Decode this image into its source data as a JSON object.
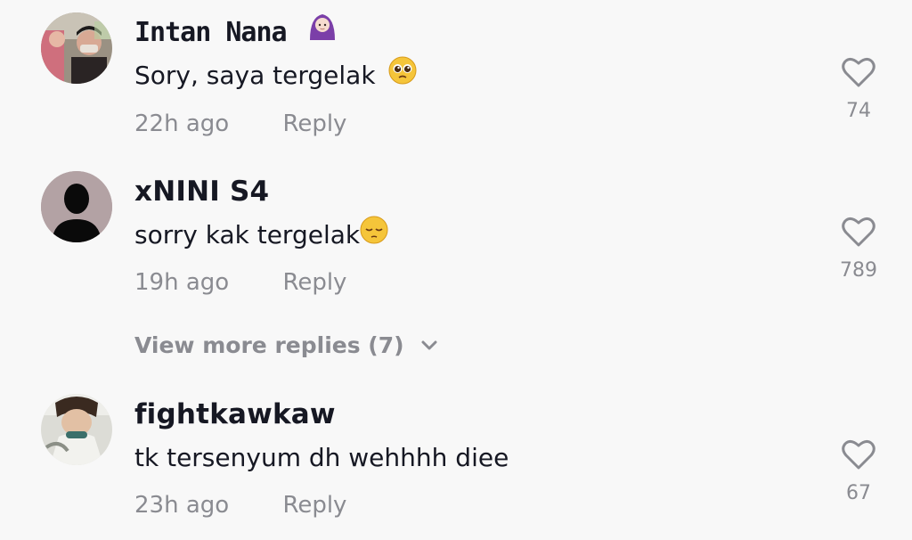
{
  "comments": [
    {
      "username": "Intan Nana",
      "username_emoji_icon": "woman-with-headscarf-icon",
      "text": "Sory, saya tergelak",
      "text_emoji_icon": "pleading-face-icon",
      "time": "22h ago",
      "reply_label": "Reply",
      "likes": "74",
      "avatar_icon": "user-photo-avatar"
    },
    {
      "username": "xNINI S4",
      "text": "sorry kak tergelak",
      "text_emoji_icon": "pensive-face-icon",
      "time": "19h ago",
      "reply_label": "Reply",
      "likes": "789",
      "avatar_icon": "default-silhouette-avatar"
    },
    {
      "username": "fightkawkaw",
      "text": "tk tersenyum dh wehhhh diee",
      "time": "23h ago",
      "reply_label": "Reply",
      "likes": "67",
      "avatar_icon": "user-photo-avatar"
    }
  ],
  "view_more_replies": "View more replies (7)",
  "colors": {
    "background": "#f8f8f8",
    "primary_text": "#161823",
    "secondary_text": "#8a8b91"
  }
}
